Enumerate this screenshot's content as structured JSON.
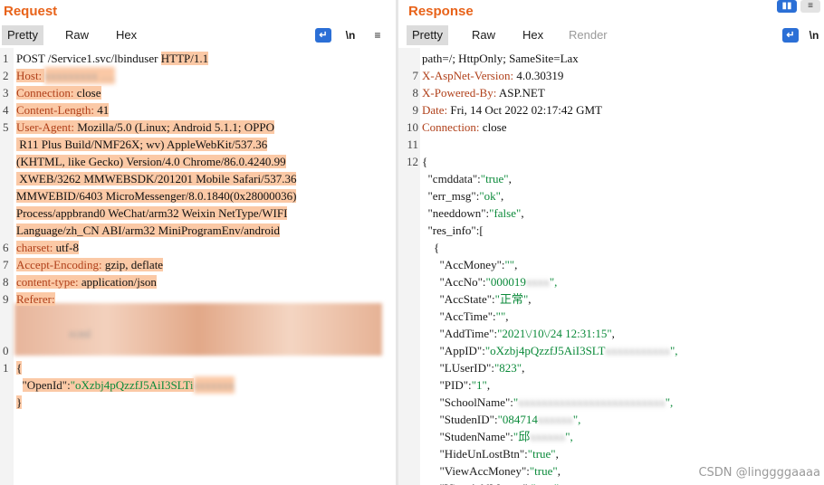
{
  "request": {
    "title": "Request",
    "tabs": [
      "Pretty",
      "Raw",
      "Hex"
    ],
    "active_tab": "Pretty",
    "tools": {
      "wrap": "↵",
      "newline": "\\n",
      "menu": "≡"
    },
    "lines": [
      {
        "n": "1",
        "parts": [
          {
            "t": "POST /Service1.svc/lbinduser "
          },
          {
            "t": "HTTP/1.1",
            "c": "hl"
          }
        ]
      },
      {
        "n": "2",
        "parts": [
          {
            "t": "Host:",
            "c": "hl hl-key"
          },
          {
            "t": " ",
            "c": "hl"
          },
          {
            "t": "xxxxxxxxx .....",
            "c": "hl blur"
          }
        ]
      },
      {
        "n": "3",
        "parts": [
          {
            "t": "Connection:",
            "c": "hl hl-key"
          },
          {
            "t": " close",
            "c": "hl"
          }
        ]
      },
      {
        "n": "4",
        "parts": [
          {
            "t": "Content-Length:",
            "c": "hl hl-key"
          },
          {
            "t": " 41",
            "c": "hl"
          }
        ]
      },
      {
        "n": "5",
        "parts": [
          {
            "t": "User-Agent:",
            "c": "hl hl-key"
          },
          {
            "t": " Mozilla/5.0 (Linux; Android 5.1.1; OPPO",
            "c": "hl"
          }
        ]
      },
      {
        "n": "",
        "parts": [
          {
            "t": " R11 Plus Build/NMF26X; wv) AppleWebKit/537.36",
            "c": "hl"
          }
        ]
      },
      {
        "n": "",
        "parts": [
          {
            "t": "(KHTML, like Gecko) Version/4.0 Chrome/86.0.4240.99",
            "c": "hl"
          }
        ]
      },
      {
        "n": "",
        "parts": [
          {
            "t": " XWEB/3262 MMWEBSDK/201201 Mobile Safari/537.36",
            "c": "hl"
          }
        ]
      },
      {
        "n": "",
        "parts": [
          {
            "t": "MMWEBID/6403 MicroMessenger/8.0.1840(0x28000036)",
            "c": "hl"
          }
        ]
      },
      {
        "n": "",
        "parts": [
          {
            "t": "Process/appbrand0 WeChat/arm32 Weixin NetType/WIFI",
            "c": "hl"
          }
        ]
      },
      {
        "n": "",
        "parts": [
          {
            "t": "Language/zh_CN ABI/arm32 MiniProgramEnv/android",
            "c": "hl"
          }
        ]
      },
      {
        "n": "6",
        "parts": [
          {
            "t": "charset:",
            "c": "hl hl-key"
          },
          {
            "t": " utf-8",
            "c": "hl"
          }
        ]
      },
      {
        "n": "7",
        "parts": [
          {
            "t": "Accept-Encoding:",
            "c": "hl hl-key"
          },
          {
            "t": " gzip, deflate",
            "c": "hl"
          }
        ]
      },
      {
        "n": "8",
        "parts": [
          {
            "t": "content-type:",
            "c": "hl hl-key"
          },
          {
            "t": " application/json",
            "c": "hl"
          }
        ]
      },
      {
        "n": "9",
        "parts": [
          {
            "t": "Referer:",
            "c": "hl hl-key"
          }
        ]
      },
      {
        "n": "",
        "parts": []
      },
      {
        "n": "",
        "parts": [
          {
            "t": "                  rcml",
            "c": "blur"
          }
        ]
      },
      {
        "n": "0",
        "parts": []
      },
      {
        "n": "1",
        "parts": [
          {
            "t": "{",
            "c": "hl"
          }
        ]
      },
      {
        "n": "",
        "parts": [
          {
            "t": "  "
          },
          {
            "t": "\"OpenId\":",
            "c": "hl jkey"
          },
          {
            "t": "\"oXzbj4pQzzfJ5AiI3SLTi",
            "c": "hl jstr"
          },
          {
            "t": "xxxxxxx",
            "c": "hl blur"
          }
        ]
      },
      {
        "n": "",
        "parts": [
          {
            "t": "}",
            "c": "hl"
          }
        ]
      }
    ]
  },
  "response": {
    "title": "Response",
    "tabs": [
      "Pretty",
      "Raw",
      "Hex",
      "Render"
    ],
    "active_tab": "Pretty",
    "disabled_tab": "Render",
    "tools": {
      "wrap": "↵",
      "newline": "\\n"
    },
    "layout_buttons": [
      "▮▮",
      "≡"
    ],
    "lines": [
      {
        "n": "",
        "parts": [
          {
            "t": "path=/; HttpOnly; SameSite=Lax"
          }
        ]
      },
      {
        "n": "7",
        "parts": [
          {
            "t": "X-AspNet-Version:",
            "c": "hl-key"
          },
          {
            "t": " 4.0.30319"
          }
        ]
      },
      {
        "n": "8",
        "parts": [
          {
            "t": "X-Powered-By:",
            "c": "hl-key"
          },
          {
            "t": " ASP.NET"
          }
        ]
      },
      {
        "n": "9",
        "parts": [
          {
            "t": "Date:",
            "c": "hl-key"
          },
          {
            "t": " Fri, 14 Oct 2022 02:17:42 GMT"
          }
        ]
      },
      {
        "n": "10",
        "parts": [
          {
            "t": "Connection:",
            "c": "hl-key"
          },
          {
            "t": " close"
          }
        ]
      },
      {
        "n": "11",
        "parts": []
      },
      {
        "n": "12",
        "parts": [
          {
            "t": "{"
          }
        ]
      },
      {
        "n": "",
        "parts": [
          {
            "t": "  \"cmddata\":",
            "c": "jkey"
          },
          {
            "t": "\"true\"",
            "c": "jstr"
          },
          {
            "t": ","
          }
        ]
      },
      {
        "n": "",
        "parts": [
          {
            "t": "  \"err_msg\":",
            "c": "jkey"
          },
          {
            "t": "\"ok\"",
            "c": "jstr"
          },
          {
            "t": ","
          }
        ]
      },
      {
        "n": "",
        "parts": [
          {
            "t": "  \"needdown\":",
            "c": "jkey"
          },
          {
            "t": "\"false\"",
            "c": "jstr"
          },
          {
            "t": ","
          }
        ]
      },
      {
        "n": "",
        "parts": [
          {
            "t": "  \"res_info\":["
          }
        ]
      },
      {
        "n": "",
        "parts": [
          {
            "t": "    {"
          }
        ]
      },
      {
        "n": "",
        "parts": [
          {
            "t": "      \"AccMoney\":",
            "c": "jkey"
          },
          {
            "t": "\"\"",
            "c": "jstr"
          },
          {
            "t": ","
          }
        ]
      },
      {
        "n": "",
        "parts": [
          {
            "t": "      \"AccNo\":",
            "c": "jkey"
          },
          {
            "t": "\"000019",
            "c": "jstr"
          },
          {
            "t": "xxxx",
            "c": "blur"
          },
          {
            "t": "\",",
            "c": "jstr"
          }
        ]
      },
      {
        "n": "",
        "parts": [
          {
            "t": "      \"AccState\":",
            "c": "jkey"
          },
          {
            "t": "\"正常\"",
            "c": "jstr"
          },
          {
            "t": ","
          }
        ]
      },
      {
        "n": "",
        "parts": [
          {
            "t": "      \"AccTime\":",
            "c": "jkey"
          },
          {
            "t": "\"\"",
            "c": "jstr"
          },
          {
            "t": ","
          }
        ]
      },
      {
        "n": "",
        "parts": [
          {
            "t": "      \"AddTime\":",
            "c": "jkey"
          },
          {
            "t": "\"2021\\/10\\/24 12:31:15\"",
            "c": "jstr"
          },
          {
            "t": ","
          }
        ]
      },
      {
        "n": "",
        "parts": [
          {
            "t": "      \"AppID\":",
            "c": "jkey"
          },
          {
            "t": "\"oXzbj4pQzzfJ5AiI3SLT",
            "c": "jstr"
          },
          {
            "t": "xxxxxxxxxxx",
            "c": "blur"
          },
          {
            "t": "\",",
            "c": "jstr"
          }
        ]
      },
      {
        "n": "",
        "parts": [
          {
            "t": "      \"LUserID\":",
            "c": "jkey"
          },
          {
            "t": "\"823\"",
            "c": "jstr"
          },
          {
            "t": ","
          }
        ]
      },
      {
        "n": "",
        "parts": [
          {
            "t": "      \"PID\":",
            "c": "jkey"
          },
          {
            "t": "\"1\"",
            "c": "jstr"
          },
          {
            "t": ","
          }
        ]
      },
      {
        "n": "",
        "parts": [
          {
            "t": "      \"SchoolName\":",
            "c": "jkey"
          },
          {
            "t": "\"",
            "c": "jstr"
          },
          {
            "t": "xxxxxxxxxxxxxxxxxxxxxxxxx",
            "c": "blur"
          },
          {
            "t": "\",",
            "c": "jstr"
          }
        ]
      },
      {
        "n": "",
        "parts": [
          {
            "t": "      \"StudenID\":",
            "c": "jkey"
          },
          {
            "t": "\"084714",
            "c": "jstr"
          },
          {
            "t": "xxxxxx",
            "c": "blur"
          },
          {
            "t": "\",",
            "c": "jstr"
          }
        ]
      },
      {
        "n": "",
        "parts": [
          {
            "t": "      \"StudenName\":",
            "c": "jkey"
          },
          {
            "t": "\"邱",
            "c": "jstr"
          },
          {
            "t": "xxxxxx",
            "c": "blur"
          },
          {
            "t": "\",",
            "c": "jstr"
          }
        ]
      },
      {
        "n": "",
        "parts": [
          {
            "t": "      \"HideUnLostBtn\":",
            "c": "jkey"
          },
          {
            "t": "\"true\"",
            "c": "jstr"
          },
          {
            "t": ","
          }
        ]
      },
      {
        "n": "",
        "parts": [
          {
            "t": "      \"ViewAccMoney\":",
            "c": "jkey"
          },
          {
            "t": "\"true\"",
            "c": "jstr"
          },
          {
            "t": ","
          }
        ]
      },
      {
        "n": "",
        "parts": [
          {
            "t": "      \"ViewAddMoney\":",
            "c": "jkey"
          },
          {
            "t": "\"true\"",
            "c": "jstr"
          }
        ]
      }
    ]
  },
  "watermark": "CSDN @linggggaaaa",
  "colors": {
    "accent": "#e8631a",
    "highlight": "#fbc9a6",
    "string": "#0b8a3a",
    "key_red": "#b0401a",
    "active_tab": "#dcdcdc",
    "tool_blue": "#2b6fd6"
  }
}
